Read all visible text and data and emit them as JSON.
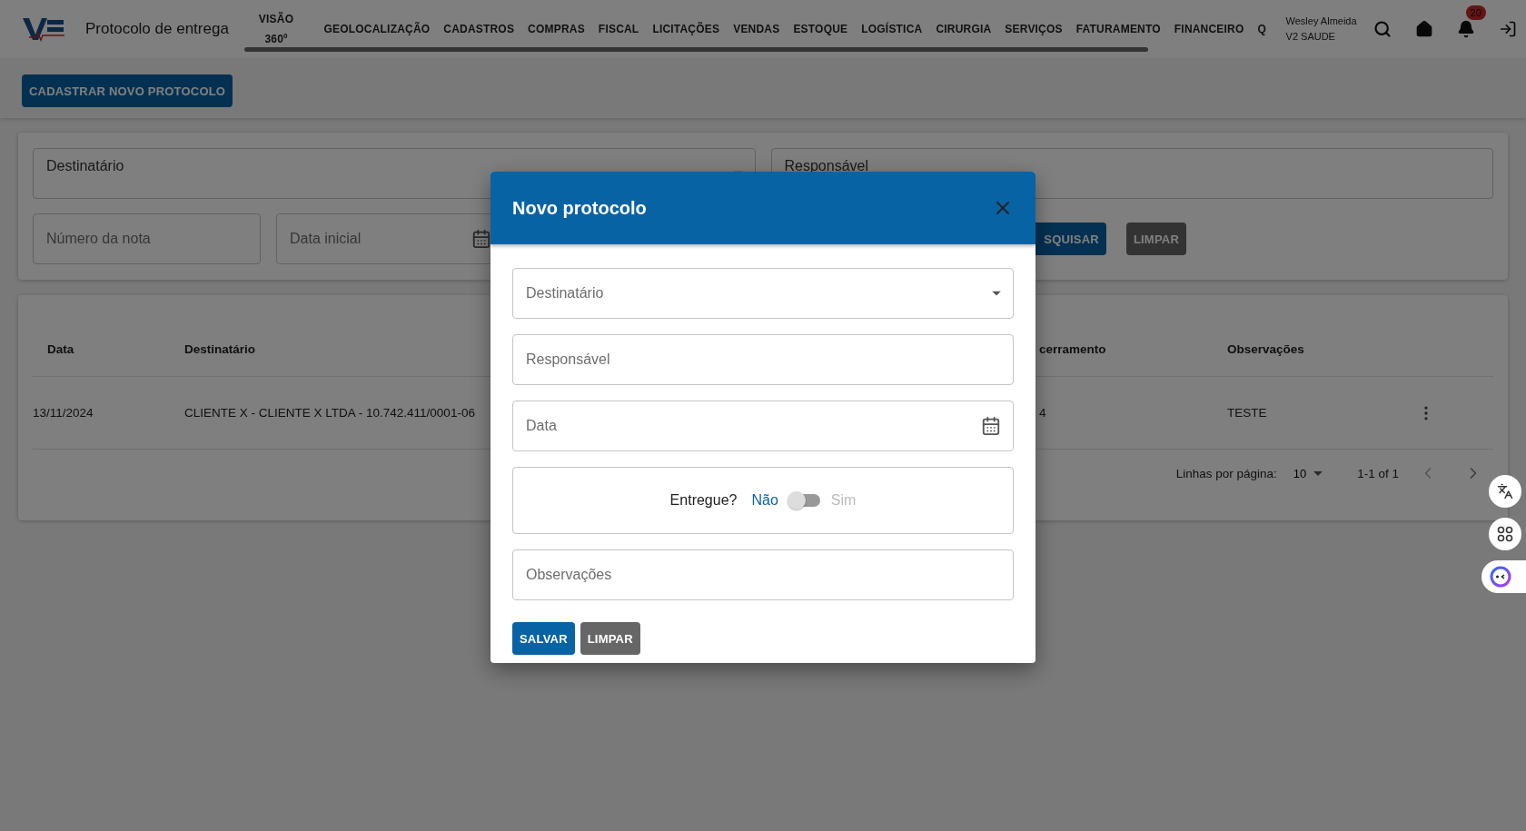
{
  "header": {
    "title": "Protocolo de entrega",
    "nav": [
      "VISÃO 360º",
      "GEOLOCALIZAÇÃO",
      "CADASTROS",
      "COMPRAS",
      "FISCAL",
      "LICITAÇÕES",
      "VENDAS",
      "ESTOQUE",
      "LOGÍSTICA",
      "CIRURGIA",
      "SERVIÇOS",
      "FATURAMENTO",
      "FINANCEIRO",
      "Q"
    ],
    "user": {
      "name": "Wesley Almeida",
      "company": "V2 SAUDE"
    },
    "notifications": "20"
  },
  "actions": {
    "new_button": "CADASTRAR NOVO PROTOCOLO"
  },
  "filters": {
    "fields": [
      {
        "kind": "select",
        "placeholder": "Destinatário"
      },
      {
        "kind": "text",
        "placeholder": "Responsável"
      },
      {
        "kind": "text",
        "placeholder": "Número da nota"
      },
      {
        "kind": "date",
        "placeholder": "Data inicial"
      }
    ],
    "buttons": [
      {
        "kind": "primary",
        "label": "SQUISAR"
      },
      {
        "kind": "secondary",
        "label": "LIMPAR"
      }
    ]
  },
  "table": {
    "columns": [
      "Data",
      "Destinatário",
      "cerramento",
      "Observações"
    ],
    "rows": [
      {
        "cells": [
          "13/11/2024",
          "CLIENTE X - CLIENTE X LTDA - 10.742.411/0001-06",
          "4",
          "TESTE"
        ]
      }
    ],
    "pagination": {
      "rows_label": "Linhas por página:",
      "rows_per_page": "10",
      "range": "1-1 of 1"
    }
  },
  "modal": {
    "title": "Novo protocolo",
    "fields": [
      {
        "kind": "select",
        "placeholder": "Destinatário"
      },
      {
        "kind": "text",
        "placeholder": "Responsável"
      },
      {
        "kind": "date",
        "placeholder": "Data"
      },
      {
        "kind": "toggle",
        "label": "Entregue?",
        "off_label": "Não",
        "on_label": "Sim",
        "on": false
      },
      {
        "kind": "text",
        "placeholder": "Observações"
      }
    ],
    "buttons": [
      {
        "kind": "primary",
        "label": "SALVAR"
      },
      {
        "kind": "secondary",
        "label": "LIMPAR"
      }
    ]
  }
}
